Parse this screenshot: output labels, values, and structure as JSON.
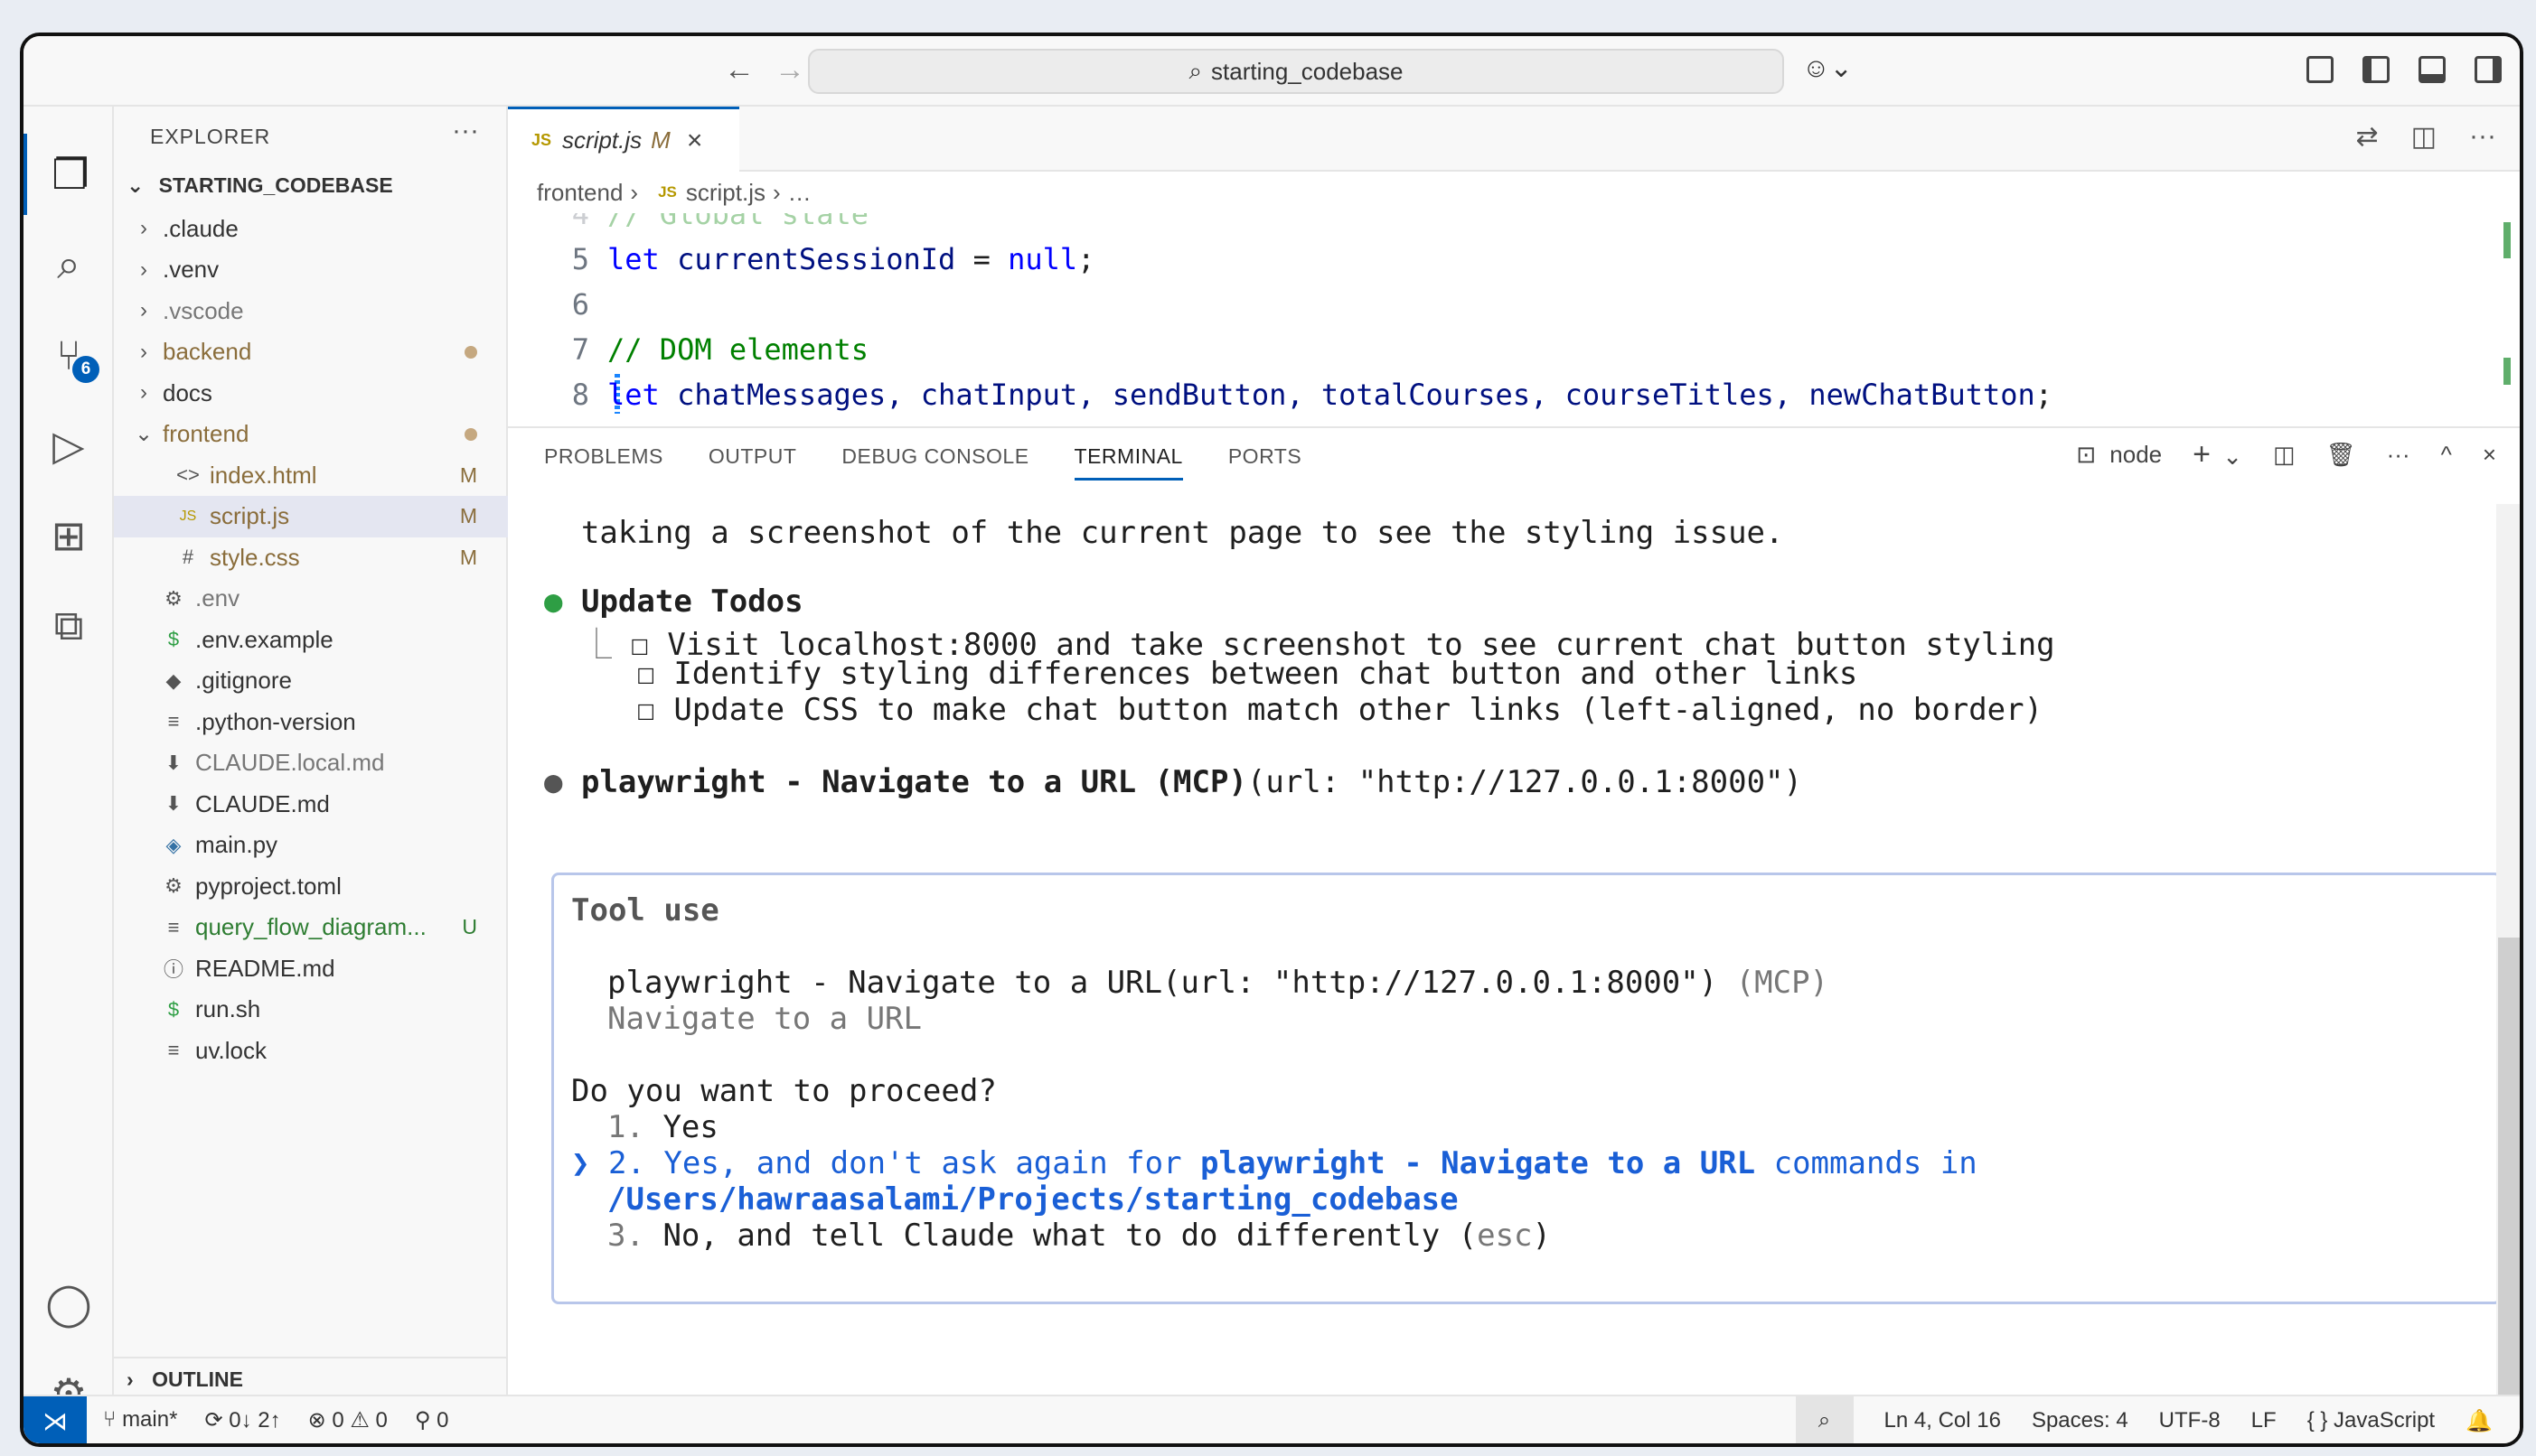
{
  "titlebar": {
    "back_icon": "←",
    "forward_icon": "→",
    "search_icon": "⌕",
    "command_center": "starting_codebase",
    "copilot_icon": "☺⌄"
  },
  "activity": {
    "explorer_icon": "❐",
    "search_icon": "⌕",
    "scm_icon": "⑂",
    "scm_badge": "6",
    "run_icon": "▷",
    "extensions_icon": "⊞",
    "remote_explorer_icon": "⧉",
    "account_icon": "◯",
    "settings_icon": "⚙"
  },
  "sidebar": {
    "header": "EXPLORER",
    "more": "···",
    "root": "STARTING_CODEBASE",
    "root_chevron": "⌄",
    "outline": "OUTLINE",
    "outline_chevron": "›",
    "items": [
      {
        "label": ".claude",
        "chev": "›",
        "icon": "",
        "status": "",
        "color": "#333333"
      },
      {
        "label": ".venv",
        "chev": "›",
        "icon": "",
        "status": "",
        "color": "#333333"
      },
      {
        "label": ".vscode",
        "chev": "›",
        "icon": "",
        "status": "",
        "color": "#777777"
      },
      {
        "label": "backend",
        "chev": "›",
        "icon": "",
        "status": "dot",
        "color": "#8a6d3b"
      },
      {
        "label": "docs",
        "chev": "›",
        "icon": "",
        "status": "",
        "color": "#333333"
      },
      {
        "label": "frontend",
        "chev": "⌄",
        "icon": "",
        "status": "dot",
        "color": "#8a6d3b"
      },
      {
        "label": "index.html",
        "chev": "",
        "icon": "<>",
        "status": "M",
        "color": "#8a6d3b"
      },
      {
        "label": "script.js",
        "chev": "",
        "icon": "JS",
        "status": "M",
        "color": "#8a6d3b"
      },
      {
        "label": "style.css",
        "chev": "",
        "icon": "#",
        "status": "M",
        "color": "#8a6d3b"
      },
      {
        "label": ".env",
        "chev": "",
        "icon": "⚙",
        "status": "",
        "color": "#777777"
      },
      {
        "label": ".env.example",
        "chev": "",
        "icon": "$",
        "status": "",
        "color": "#333333"
      },
      {
        "label": ".gitignore",
        "chev": "",
        "icon": "◆",
        "status": "",
        "color": "#333333"
      },
      {
        "label": ".python-version",
        "chev": "",
        "icon": "≡",
        "status": "",
        "color": "#333333"
      },
      {
        "label": "CLAUDE.local.md",
        "chev": "",
        "icon": "⬇",
        "status": "",
        "color": "#777777"
      },
      {
        "label": "CLAUDE.md",
        "chev": "",
        "icon": "⬇",
        "status": "",
        "color": "#333333"
      },
      {
        "label": "main.py",
        "chev": "",
        "icon": "◈",
        "status": "",
        "color": "#333333"
      },
      {
        "label": "pyproject.toml",
        "chev": "",
        "icon": "⚙",
        "status": "",
        "color": "#333333"
      },
      {
        "label": "query_flow_diagram...",
        "chev": "",
        "icon": "≡",
        "status": "U",
        "color": "#2e7d32"
      },
      {
        "label": "README.md",
        "chev": "",
        "icon": "ⓘ",
        "status": "",
        "color": "#333333"
      },
      {
        "label": "run.sh",
        "chev": "",
        "icon": "$",
        "status": "",
        "color": "#333333"
      },
      {
        "label": "uv.lock",
        "chev": "",
        "icon": "≡",
        "status": "",
        "color": "#333333"
      }
    ]
  },
  "editor": {
    "tab": {
      "js": "JS",
      "name": "script.js",
      "mod": "M",
      "close": "×"
    },
    "actions": [
      "⇄",
      "◫",
      "···"
    ],
    "breadcrumb": {
      "folder": "frontend",
      "sep": "›",
      "js": "JS",
      "file": "script.js",
      "more": "…"
    },
    "lines": [
      {
        "n": "4",
        "text": "// Global state",
        "kind": "cm"
      },
      {
        "n": "5",
        "text": "",
        "kind": "l5"
      },
      {
        "n": "6",
        "text": "",
        "kind": "blank"
      },
      {
        "n": "7",
        "text": "// DOM elements",
        "kind": "cm"
      },
      {
        "n": "8",
        "text": "",
        "kind": "l8"
      }
    ],
    "l5": {
      "kw": "let",
      "var": "currentSessionId",
      "eq": " = ",
      "val": "null",
      "end": ";"
    },
    "l8": {
      "kw": "let",
      "vars": "chatMessages, chatInput, sendButton, totalCourses, courseTitles, newChatButton",
      "end": ";"
    }
  },
  "panel": {
    "tabs": [
      "PROBLEMS",
      "OUTPUT",
      "DEBUG CONSOLE",
      "TERMINAL",
      "PORTS"
    ],
    "active_tab": "TERMINAL",
    "terminal_name": "node",
    "terminal_icon": "⊡",
    "add_icon": "+",
    "dropdown_icon": "⌄",
    "split_icon": "◫",
    "trash_icon": "🗑",
    "more_icon": "···",
    "maximize_icon": "^",
    "close_icon": "×"
  },
  "terminal": {
    "line1": "  taking a screenshot of the current page to see the styling issue.",
    "todos_bullet": "●",
    "todos_title": "Update Todos",
    "todo_branch": "  ⎿",
    "todo_box": "☐",
    "todos": [
      "Visit localhost:8000 and take screenshot to see current chat button styling",
      "Identify styling differences between chat button and other links",
      "Update CSS to make chat button match other links (left-aligned, no border)"
    ],
    "pw_bullet": "●",
    "pw_bold": "playwright - Navigate to a URL (MCP)",
    "pw_args": "(url: \"http://127.0.0.1:8000\")",
    "tool_title": "Tool use",
    "tool_call": "playwright - Navigate to a URL(url: \"http://127.0.0.1:8000\")",
    "tool_mcp": "(MCP)",
    "tool_desc": "Navigate to a URL",
    "question": "Do you want to proceed?",
    "opt1_num": "1.",
    "opt1": "Yes",
    "cursor": "❯",
    "opt2_num": "2.",
    "opt2_a": "Yes, and don't ask again for ",
    "opt2_b": "playwright - Navigate to a URL",
    "opt2_c": " commands in",
    "opt2_path": "/Users/hawraasalami/Projects/starting_codebase",
    "opt3_num": "3.",
    "opt3": "No, and tell Claude what to do differently (",
    "opt3_esc": "esc",
    "opt3_end": ")"
  },
  "statusbar": {
    "remote_icon": "⋊",
    "branch": "⑂ main*",
    "sync": "⟳ 0↓ 2↑",
    "problems": "⊗ 0 ⚠ 0",
    "ports": "⚲ 0",
    "zoom_icon": "⌕",
    "position": "Ln 4, Col 16",
    "spaces": "Spaces: 4",
    "encoding": "UTF-8",
    "eol": "LF",
    "language": "{ } JavaScript",
    "bell": "🔔"
  }
}
